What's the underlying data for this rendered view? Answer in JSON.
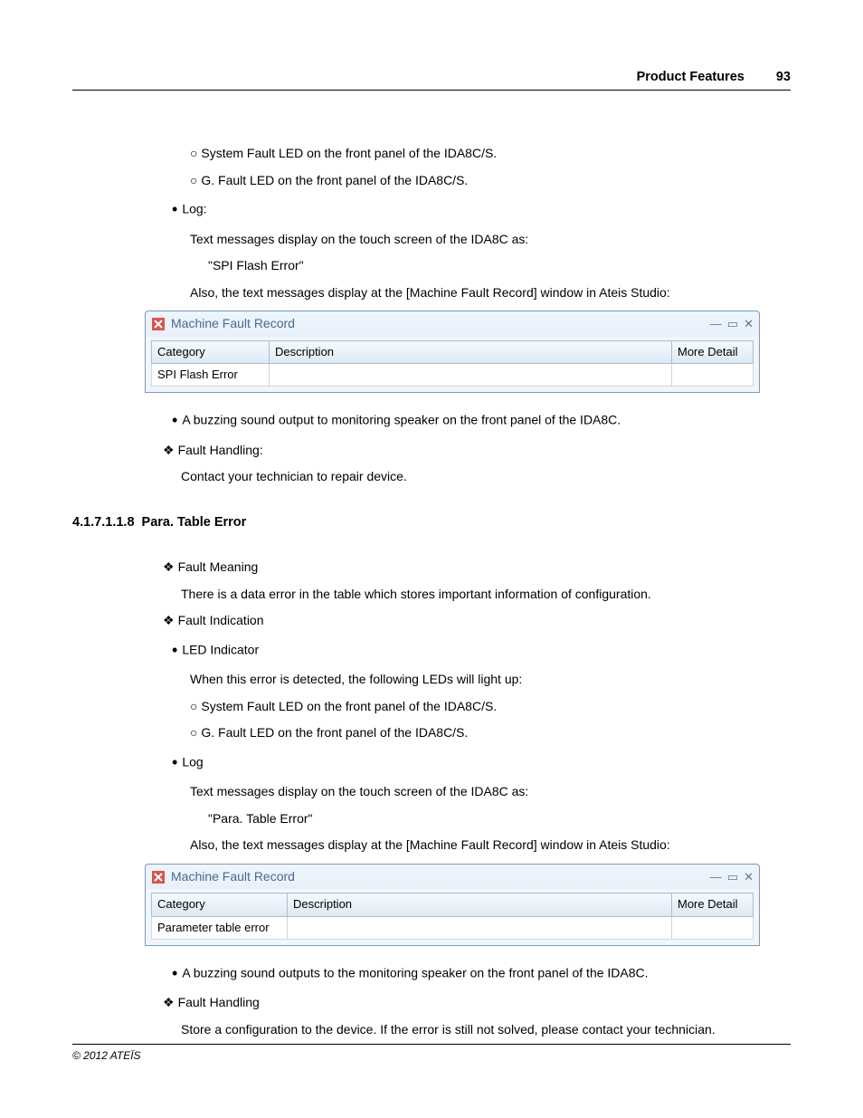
{
  "header": {
    "title": "Product Features",
    "page": "93"
  },
  "section1": {
    "circ1": "System Fault LED on the front panel of the IDA8C/S.",
    "circ2": "G. Fault LED on the front panel of the IDA8C/S.",
    "log_label": "Log:",
    "log_text1": "Text messages display on the touch screen of the IDA8C as:",
    "log_text2": "\"SPI Flash Error\"",
    "log_text3": "Also, the text messages display at the [Machine Fault Record] window in Ateis Studio:",
    "buzz": "A buzzing sound output to monitoring speaker on the front panel of the IDA8C.",
    "fh_label": "Fault Handling:",
    "fh_text": "Contact your technician to repair device."
  },
  "win1": {
    "title": "Machine Fault Record",
    "cols": {
      "c1": "Category",
      "c2": "Description",
      "c3": "More Detail"
    },
    "row": {
      "c1": "SPI Flash Error",
      "c2": "",
      "c3": ""
    }
  },
  "sect_heading": {
    "num": "4.1.7.1.1.8",
    "title": "Para. Table Error"
  },
  "section2": {
    "fm_label": "Fault Meaning",
    "fm_text": "There is a data error in the table which stores important information of configuration.",
    "fi_label": "Fault Indication",
    "led_label": "LED Indicator",
    "led_text": "When this error is detected, the following LEDs will light up:",
    "circ1": "System Fault LED on the front panel of the IDA8C/S.",
    "circ2": "G. Fault LED on the front panel of the IDA8C/S.",
    "log_label": "Log",
    "log_text1": "Text messages display on the touch screen of the IDA8C as:",
    "log_text2": "\"Para. Table Error\"",
    "log_text3": "Also, the text messages display at the [Machine Fault Record] window in Ateis Studio:",
    "buzz": "A buzzing sound outputs to the monitoring speaker on the front panel of the IDA8C.",
    "fh_label": "Fault Handling",
    "fh_text": "Store a configuration to the device. If the error is still not solved, please contact your technician."
  },
  "win2": {
    "title": "Machine Fault Record",
    "cols": {
      "c1": "Category",
      "c2": "Description",
      "c3": "More Detail"
    },
    "row": {
      "c1": "Parameter table error",
      "c2": "",
      "c3": ""
    }
  },
  "footer": "© 2012 ATEÏS"
}
